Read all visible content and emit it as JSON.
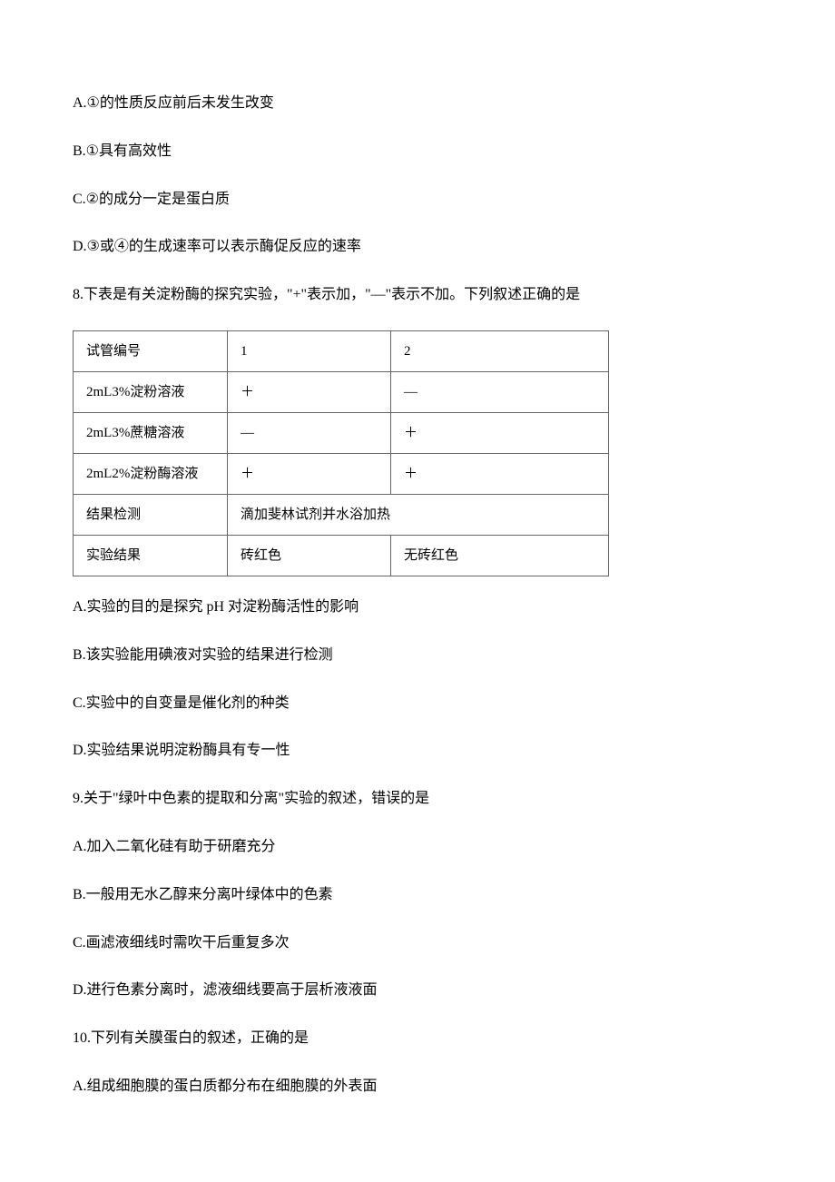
{
  "q7": {
    "optA": "A.①的性质反应前后未发生改变",
    "optB": "B.①具有高效性",
    "optC": "C.②的成分一定是蛋白质",
    "optD": "D.③或④的生成速率可以表示酶促反应的速率"
  },
  "q8": {
    "stem": "8.下表是有关淀粉酶的探究实验，\"+\"表示加，\"—\"表示不加。下列叙述正确的是",
    "table": {
      "header": {
        "c1": "试管编号",
        "c2": "1",
        "c3": "2"
      },
      "row1": {
        "c1": "2mL3%淀粉溶液",
        "c2": "＋",
        "c3": "—"
      },
      "row2": {
        "c1": "2mL3%蔗糖溶液",
        "c2": "—",
        "c3": "＋"
      },
      "row3": {
        "c1": "2mL2%淀粉酶溶液",
        "c2": "＋",
        "c3": "＋"
      },
      "row4": {
        "c1": "结果检测",
        "c23": "滴加斐林试剂并水浴加热"
      },
      "row5": {
        "c1": "实验结果",
        "c2": "砖红色",
        "c3": "无砖红色"
      }
    },
    "optA": "A.实验的目的是探究 pH 对淀粉酶活性的影响",
    "optB": "B.该实验能用碘液对实验的结果进行检测",
    "optC": "C.实验中的自变量是催化剂的种类",
    "optD": "D.实验结果说明淀粉酶具有专一性"
  },
  "q9": {
    "stem": "9.关于\"绿叶中色素的提取和分离\"实验的叙述，错误的是",
    "optA": "A.加入二氧化硅有助于研磨充分",
    "optB": "B.一般用无水乙醇来分离叶绿体中的色素",
    "optC": "C.画滤液细线时需吹干后重复多次",
    "optD": "D.进行色素分离时，滤液细线要高于层析液液面"
  },
  "q10": {
    "stem": "10.下列有关膜蛋白的叙述，正确的是",
    "optA": "A.组成细胞膜的蛋白质都分布在细胞膜的外表面"
  }
}
